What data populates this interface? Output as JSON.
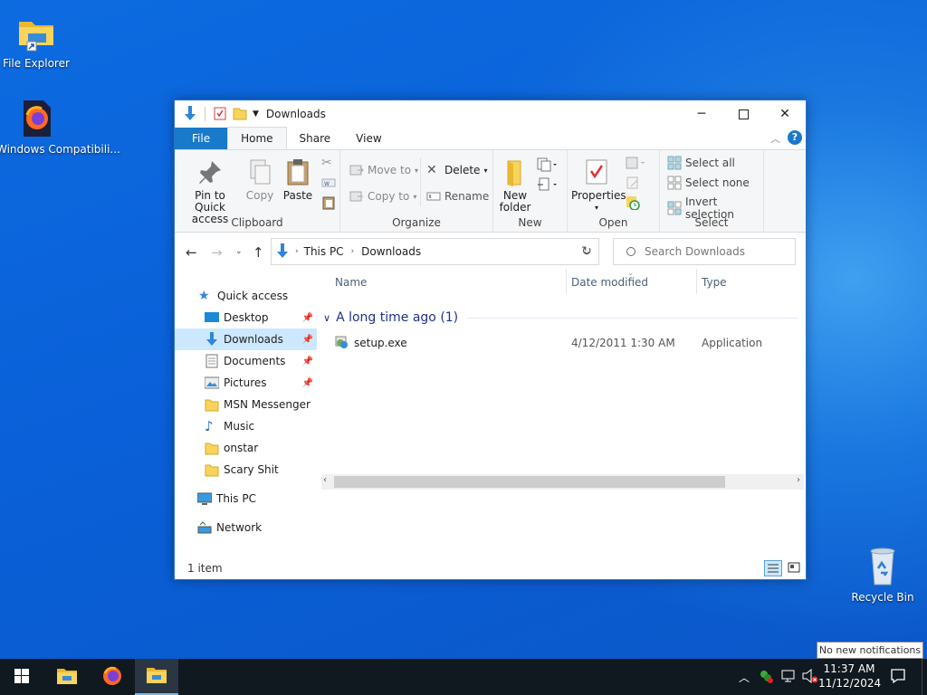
{
  "desktop": {
    "icons": [
      {
        "label": "File Explorer"
      },
      {
        "label": "Windows Compatibili..."
      },
      {
        "label": "Recycle Bin"
      }
    ]
  },
  "window": {
    "title": "Downloads",
    "tabs": [
      "File",
      "Home",
      "Share",
      "View"
    ],
    "ribbon": {
      "clipboard": {
        "pin": "Pin to Quick access",
        "copy": "Copy",
        "paste": "Paste",
        "label": "Clipboard"
      },
      "organize": {
        "move_to": "Move to",
        "copy_to": "Copy to",
        "delete": "Delete",
        "rename": "Rename",
        "label": "Organize"
      },
      "new": {
        "new_folder": "New folder",
        "label": "New"
      },
      "open": {
        "properties": "Properties",
        "label": "Open"
      },
      "select": {
        "select_all": "Select all",
        "select_none": "Select none",
        "invert": "Invert selection",
        "label": "Select"
      }
    },
    "address": {
      "crumbs": [
        "This PC",
        "Downloads"
      ],
      "search_placeholder": "Search Downloads"
    },
    "nav": {
      "quick_access": "Quick access",
      "items": [
        "Desktop",
        "Downloads",
        "Documents",
        "Pictures",
        "MSN Messenger",
        "Music",
        "onstar",
        "Scary Shit"
      ],
      "this_pc": "This PC",
      "network": "Network"
    },
    "columns": {
      "name": "Name",
      "date": "Date modified",
      "type": "Type"
    },
    "group": "A long time ago (1)",
    "files": [
      {
        "name": "setup.exe",
        "date": "4/12/2011 1:30 AM",
        "type": "Application"
      }
    ],
    "status": "1 item"
  },
  "taskbar": {
    "time": "11:37 AM",
    "date": "11/12/2024",
    "notification_tip": "No new notifications"
  },
  "colors": {
    "accent": "#1979ca",
    "selection": "#cce8ff",
    "taskbar": "#101820"
  }
}
